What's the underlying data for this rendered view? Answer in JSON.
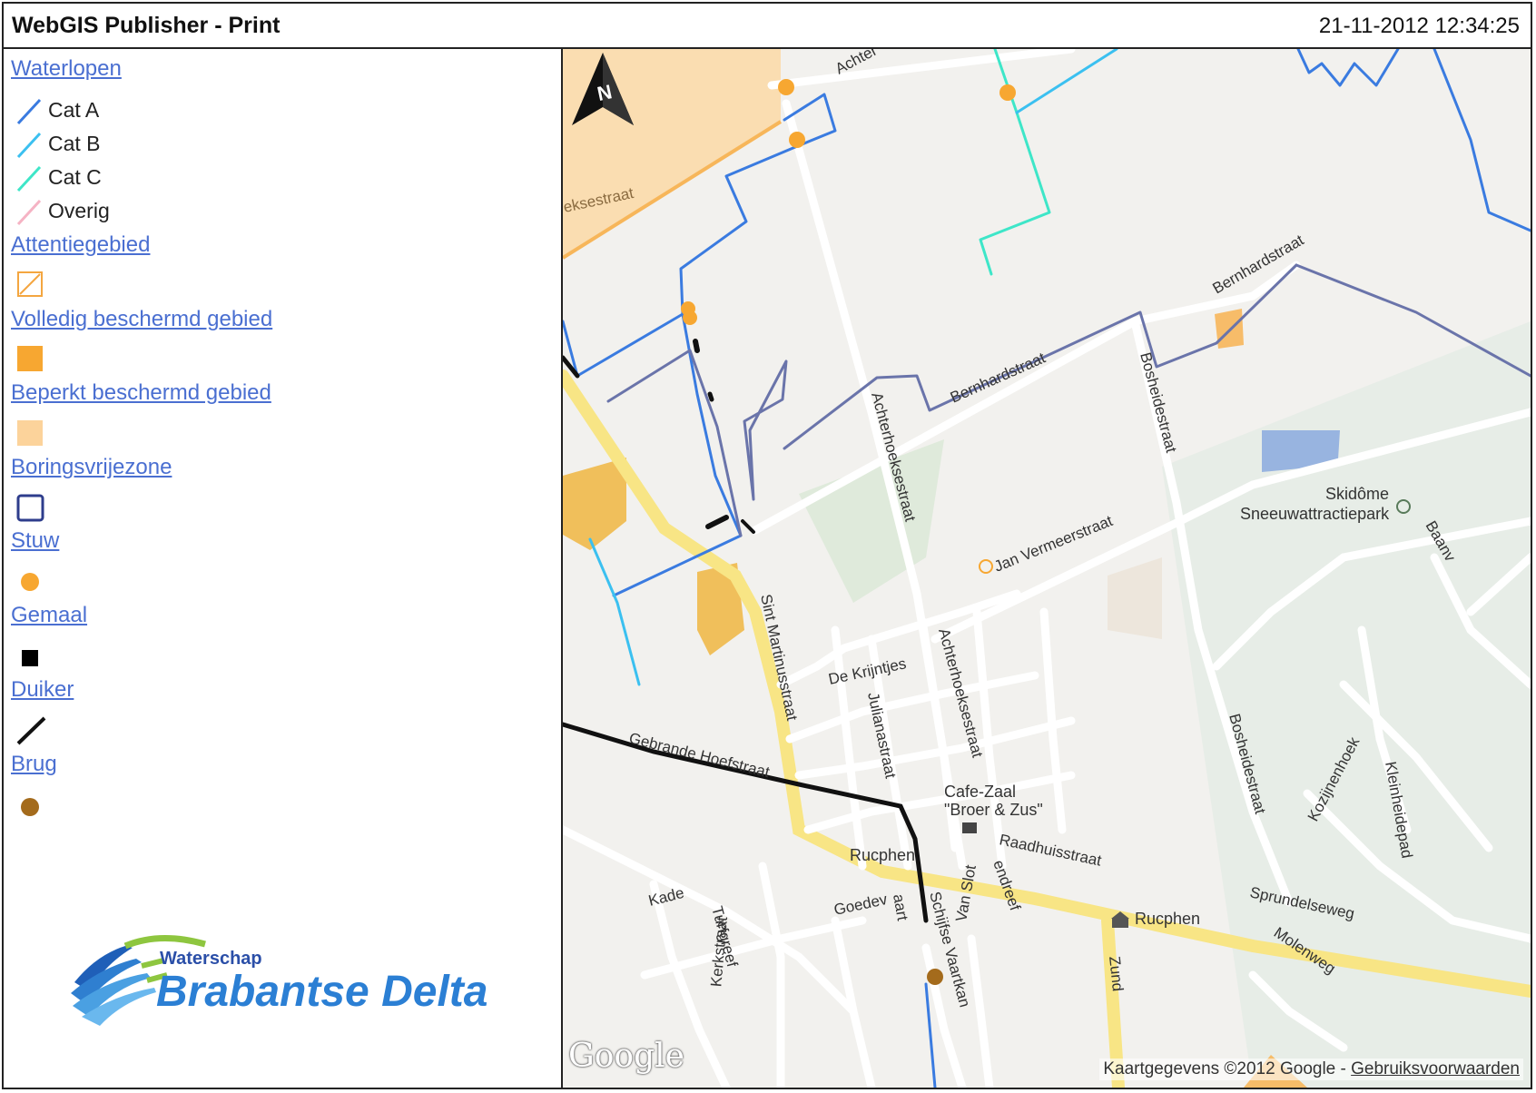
{
  "header": {
    "title": "WebGIS Publisher - Print",
    "datetime": "21-11-2012 12:34:25"
  },
  "legend": {
    "waterlopen": {
      "label": "Waterlopen",
      "items": [
        {
          "label": "Cat A",
          "color": "#3a7be0"
        },
        {
          "label": "Cat B",
          "color": "#3bc0f0"
        },
        {
          "label": "Cat C",
          "color": "#3ee6c8"
        },
        {
          "label": "Overig",
          "color": "#f5b3c4"
        }
      ]
    },
    "attentiegebied": "Attentiegebied",
    "volledig": "Volledig beschermd gebied",
    "beperkt": "Beperkt beschermd gebied",
    "boringsvrij": "Boringsvrijezone",
    "stuw": "Stuw",
    "gemaal": "Gemaal",
    "duiker": "Duiker",
    "brug": "Brug"
  },
  "logo": {
    "line1": "Waterschap",
    "line2": "Brabantse Delta"
  },
  "map": {
    "provider": "Google",
    "copyright": "Kaartgegevens ©2012 Google",
    "separator": " - ",
    "terms": "Gebruiksvoorwaarden",
    "labels": {
      "achter_top": "Achter",
      "eksestraat": "eksestraat",
      "bernhard1": "Bernhardstraat",
      "bernhard2": "Bernhardstraat",
      "achterhoek1": "Achterhoeksestraat",
      "achterhoek2": "Achterhoeksestraat",
      "bosheide1": "Bosheidestraat",
      "bosheide2": "Bosheidestraat",
      "jan": "Jan Vermeerstraat",
      "skidome": "Skidôme",
      "sneeuw": "Sneeuwattractiepark",
      "baanv": "Baanv",
      "sintmartinus": "Sint Martinusstraat",
      "krijntjes": "De Krijntjes",
      "juliana": "Julianastraat",
      "gebrande": "Gebrande Hoefstraat",
      "cafe1": "Cafe-Zaal",
      "cafe2": "\"Broer & Zus\"",
      "raadhuis": "Raadhuisstraat",
      "rucphen1": "Rucphen",
      "rucphen2": "Rucphen",
      "sprundel": "Sprundelseweg",
      "kade": "Kade",
      "turfgreef": "Turfgreef",
      "kerkstraat": "Kerkstraat",
      "goedev": "Goedev",
      "aart": "aart",
      "schijfse": "Schijfse Vaartkan",
      "vanslot": "Van Slot",
      "endreef": "endreef",
      "zund": "Zund",
      "molenweg": "Molenweg",
      "kozijnenhoek": "Kozijnenhoek",
      "kleinheidepad": "Kleinheidepad"
    }
  }
}
